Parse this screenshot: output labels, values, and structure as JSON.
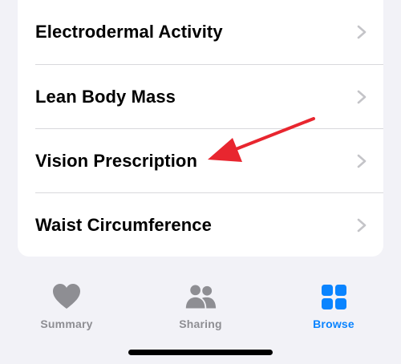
{
  "list": {
    "items": [
      {
        "label": "Electrodermal Activity"
      },
      {
        "label": "Lean Body Mass"
      },
      {
        "label": "Vision Prescription"
      },
      {
        "label": "Waist Circumference"
      }
    ]
  },
  "tab_bar": {
    "tabs": [
      {
        "label": "Summary",
        "icon": "heart-icon",
        "active": false
      },
      {
        "label": "Sharing",
        "icon": "people-icon",
        "active": false
      },
      {
        "label": "Browse",
        "icon": "grid-icon",
        "active": true
      }
    ]
  },
  "colors": {
    "background": "#f2f2f7",
    "card": "#ffffff",
    "chevron": "#c4c4c8",
    "tab_inactive": "#8e8e93",
    "tab_active": "#0a84ff",
    "annotation_arrow": "#e8262f"
  }
}
